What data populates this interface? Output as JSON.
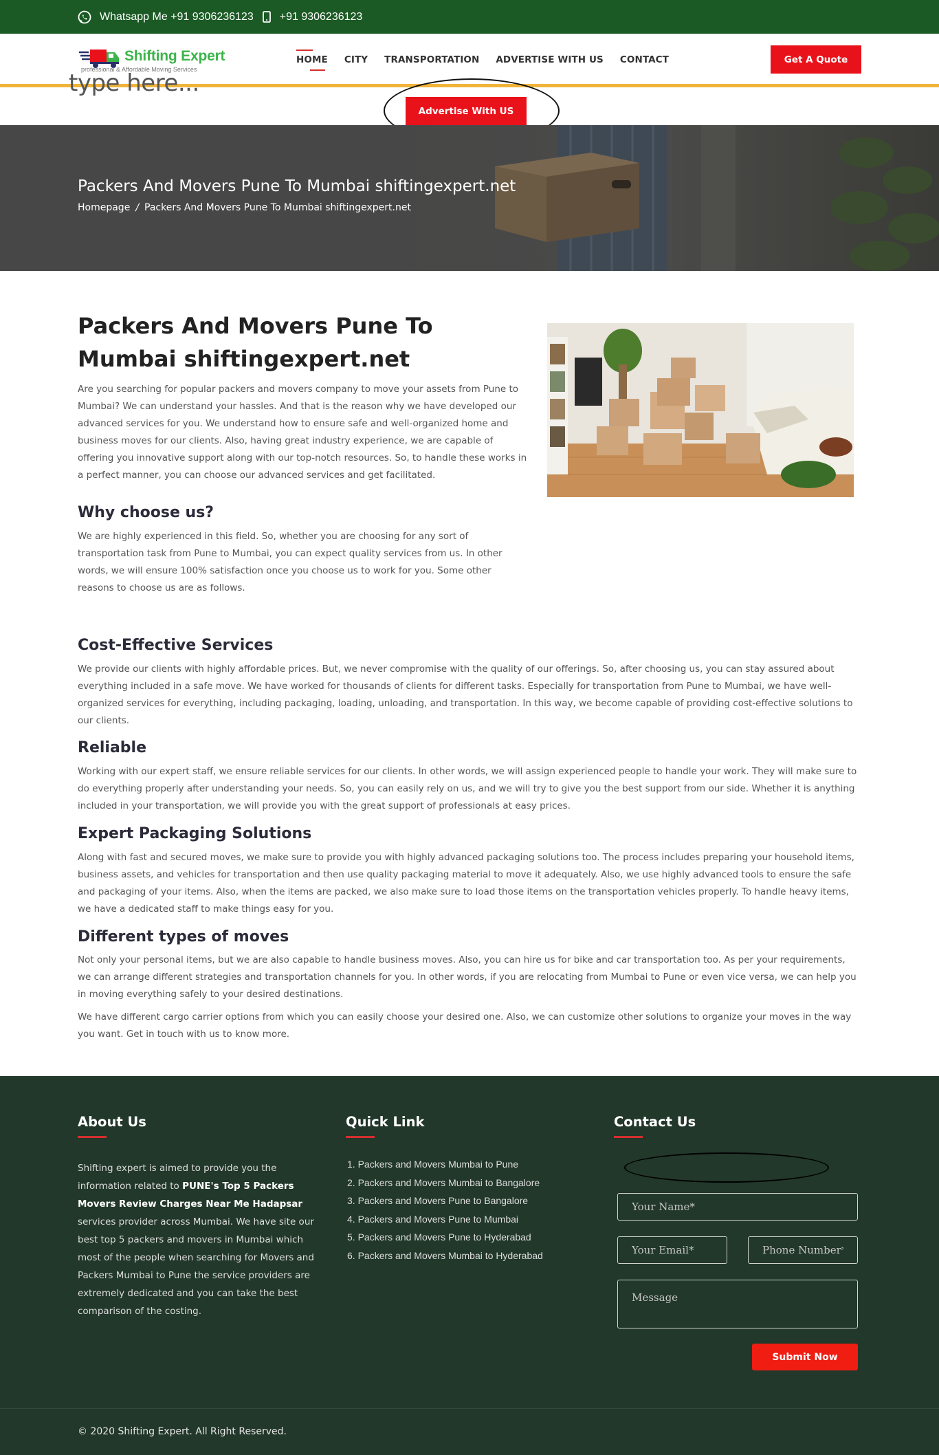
{
  "topbar": {
    "whatsapp_label": "Whatsapp Me +91 9306236123",
    "phone_label": "+91 9306236123",
    "bg_color": "#1b5a24"
  },
  "header": {
    "logo_name": "Shifting Expert",
    "logo_tagline": "professional & Affordable Moving Services",
    "nav": [
      {
        "label": "HOME",
        "active": true
      },
      {
        "label": "CITY"
      },
      {
        "label": "TRANSPORTATION"
      },
      {
        "label": "ADVERTISE WITH US"
      },
      {
        "label": "CONTACT"
      }
    ],
    "quote_button": "Get A Quote",
    "type_here": "type here...",
    "advertise_button": "Advertise With US",
    "accent_color": "#e9121b",
    "rule_color": "#f0b43a"
  },
  "banner": {
    "title": "Packers And Movers Pune To Mumbai shiftingexpert.net",
    "breadcrumb": [
      "Homepage",
      "Packers And Movers Pune To Mumbai shiftingexpert.net"
    ],
    "separator": "/"
  },
  "content": {
    "title": "Packers And Movers Pune To Mumbai shiftingexpert.net",
    "intro": "Are you searching for popular packers and movers company to move your assets from Pune to Mumbai? We can understand your hassles. And that is the reason why we have developed our advanced services for you. We understand how to ensure safe and well-organized home and business moves for our clients. Also, having great industry experience, we are capable of offering you innovative support along with our top-notch resources. So, to handle these works in a perfect manner, you can choose our advanced services and get facilitated.",
    "sections": [
      {
        "heading": "Why choose us?",
        "text": "We are highly experienced in this field. So, whether you are choosing for any sort of transportation task from Pune to Mumbai, you can expect quality services from us. In other words, we will ensure 100% satisfaction once you choose us to work for you. Some other reasons to choose us are as follows."
      },
      {
        "heading": "Cost-Effective Services",
        "text": "We provide our clients with highly affordable prices. But, we never compromise with the quality of our offerings. So, after choosing us, you can stay assured about everything included in a safe move. We have worked for thousands of clients for different tasks. Especially for transportation from Pune to Mumbai, we have well-organized services for everything, including packaging, loading, unloading, and transportation. In this way, we become capable of providing cost-effective solutions to our clients."
      },
      {
        "heading": "Reliable",
        "text": "Working with our expert staff, we ensure reliable services for our clients. In other words, we will assign experienced people to handle your work. They will make sure to do everything properly after understanding your needs. So, you can easily rely on us, and we will try to give you the best support from our side. Whether it is anything included in your transportation, we will provide you with the great support of professionals at easy prices."
      },
      {
        "heading": "Expert Packaging Solutions",
        "text": "Along with fast and secured moves, we make sure to provide you with highly advanced packaging solutions too. The process includes preparing your household items, business assets, and vehicles for transportation and then use quality packaging material to move it adequately. Also, we use highly advanced tools to ensure the safe and packaging of your items. Also, when the items are packed, we also make sure to load those items on the transportation vehicles properly. To handle heavy items, we have a dedicated staff to make things easy for you."
      },
      {
        "heading": "Different types of moves",
        "text": "Not only your personal items, but we are also capable to handle business moves. Also, you can hire us for bike and car transportation too. As per your requirements, we can arrange different strategies and transportation channels for you. In other words, if you are relocating from Mumbai to Pune or even vice versa, we can help you in moving everything safely to your desired destinations."
      }
    ],
    "closing": "We have different cargo carrier options from which you can easily choose your desired one. Also, we can customize other solutions to organize your moves in the way you want. Get in touch with us to know more."
  },
  "footer": {
    "about_heading": "About Us",
    "about_text_1": "Shifting expert is aimed to provide you the information related to ",
    "about_bold": "PUNE's Top 5 Packers Movers Review Charges Near Me Hadapsar",
    "about_text_2": " services provider across Mumbai. We have site our best top 5 packers and movers in Mumbai which most of the people when searching for Movers and Packers Mumbai to Pune the service providers are extremely dedicated and you can take the best comparison of the costing.",
    "quick_heading": "Quick Link",
    "quick_links": [
      "Packers and Movers Mumbai to Pune",
      "Packers and Movers Mumbai to Bangalore",
      "Packers and Movers Pune to Bangalore",
      "Packers and Movers Pune to Mumbai",
      "Packers and Movers Pune to Hyderabad",
      "Packers and Movers Mumbai to Hyderabad"
    ],
    "contact_heading": "Contact Us",
    "name_placeholder": "Your Name*",
    "email_placeholder": "Your Email*",
    "phone_placeholder": "Phone Number*",
    "message_placeholder": "Message",
    "submit_label": "Submit Now",
    "copyright": "© 2020 Shifting Expert. All Right Reserved.",
    "bg_color": "#22382a"
  }
}
